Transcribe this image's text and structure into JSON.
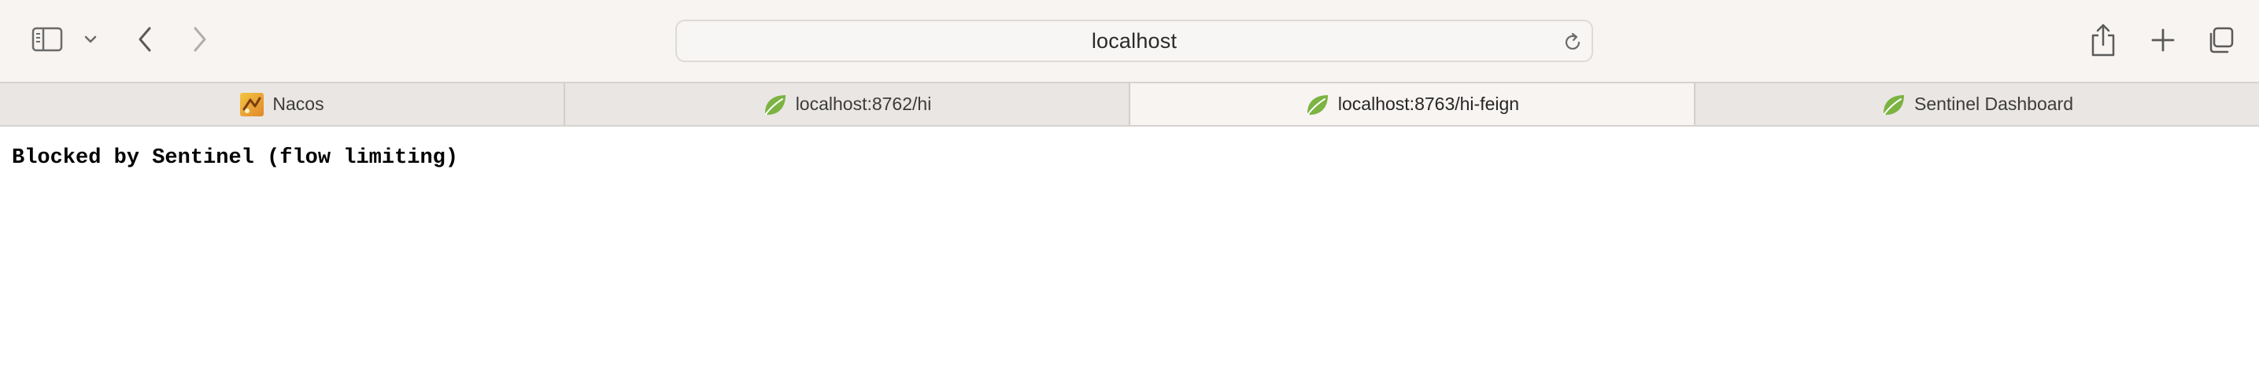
{
  "browser": {
    "address": "localhost",
    "icons": {
      "sidebar": "sidebar-icon",
      "chevron": "chevron-down-icon",
      "back": "back-arrow-icon",
      "forward": "forward-arrow-icon",
      "reload": "reload-icon",
      "share": "share-icon",
      "new_tab": "plus-icon",
      "tab_overview": "tab-overview-icon"
    }
  },
  "tabs": [
    {
      "label": "Nacos",
      "favicon": "nacos-favicon",
      "active": false
    },
    {
      "label": "localhost:8762/hi",
      "favicon": "spring-leaf-icon",
      "active": false
    },
    {
      "label": "localhost:8763/hi-feign",
      "favicon": "spring-leaf-icon",
      "active": true
    },
    {
      "label": "Sentinel Dashboard",
      "favicon": "spring-leaf-icon",
      "active": false
    }
  ],
  "page": {
    "text": "Blocked by Sentinel (flow limiting)"
  },
  "colors": {
    "toolbar_bg": "#f7f4f2",
    "tabbar_bg": "#e9e6e3",
    "leaf_green": "#7cb342"
  }
}
